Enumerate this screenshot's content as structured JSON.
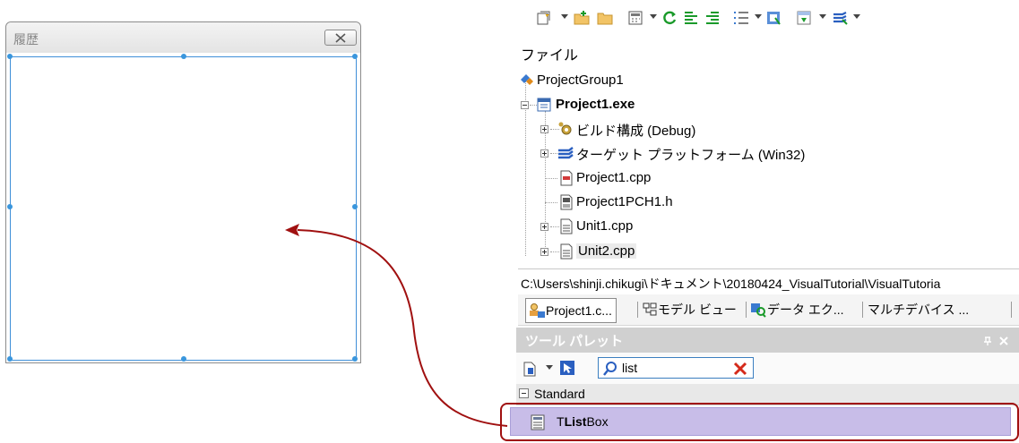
{
  "form_window": {
    "title": "履歴",
    "close_label": "✕"
  },
  "toolbar": {
    "icons": [
      "new-item-icon",
      "add-file-icon",
      "open-folder-icon",
      "calculator-icon",
      "refresh-icon",
      "align-left-icon",
      "align-right-icon",
      "list-icon",
      "component-icon",
      "deploy-icon",
      "stack-icon"
    ]
  },
  "project_tree": {
    "header": "ファイル",
    "items": [
      {
        "label": "ProjectGroup1",
        "icon": "project-group-icon"
      },
      {
        "label": "Project1.exe",
        "icon": "project-exe-icon"
      },
      {
        "label": "ビルド構成 (Debug)",
        "icon": "build-config-icon"
      },
      {
        "label": "ターゲット プラットフォーム (Win32)",
        "icon": "target-platform-icon"
      },
      {
        "label": "Project1.cpp",
        "icon": "cpp-file-icon"
      },
      {
        "label": "Project1PCH1.h",
        "icon": "header-file-icon"
      },
      {
        "label": "Unit1.cpp",
        "icon": "unit-file-icon"
      },
      {
        "label": "Unit2.cpp",
        "icon": "unit-file-icon"
      }
    ]
  },
  "path_bar": {
    "text": "C:\\Users\\shinji.chikugi\\ドキュメント\\20180424_VisualTutorial\\VisualTutoria"
  },
  "tabs": [
    {
      "label": "Project1.c..."
    },
    {
      "label": "モデル ビュー"
    },
    {
      "label": "データ エク..."
    },
    {
      "label": "マルチデバイス ..."
    }
  ],
  "tool_palette": {
    "title": "ツール パレット",
    "search_value": "list",
    "category": "Standard",
    "item_prefix": "T",
    "item_match": "List",
    "item_suffix": "Box"
  },
  "colors": {
    "accent_blue": "#3a96dd",
    "arrow_red": "#a01010",
    "selected_item": "#c8bde8"
  }
}
